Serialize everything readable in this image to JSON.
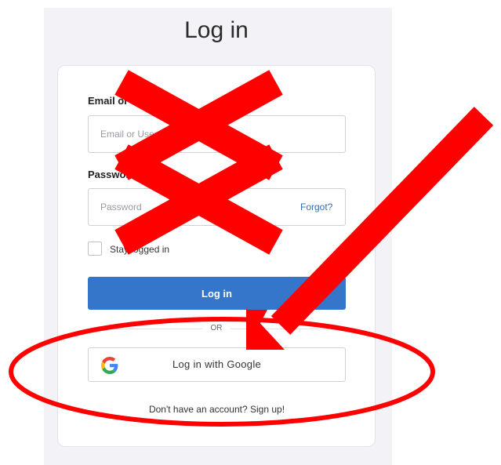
{
  "page": {
    "title": "Log in"
  },
  "form": {
    "email_label": "Email or Username",
    "email_placeholder": "Email or Username",
    "password_label": "Password",
    "password_placeholder": "Password",
    "forgot_link": "Forgot?",
    "stay_logged_in_label": "Stay logged in",
    "stay_logged_in_checked": false,
    "login_button": "Log in",
    "divider_text": "OR",
    "google_button": "Log in with Google",
    "signup_text": "Don't have an account? Sign up!"
  },
  "icons": {
    "google": "google-g-logo",
    "checkbox": "empty-checkbox"
  },
  "colors": {
    "panel_background": "#f2f2f7",
    "primary_button": "#3576cb",
    "link": "#2f6db5",
    "annotation": "#ff0000",
    "google_blue": "#4285f4",
    "google_red": "#ea4335",
    "google_yellow": "#fbbc05",
    "google_green": "#34a853"
  }
}
